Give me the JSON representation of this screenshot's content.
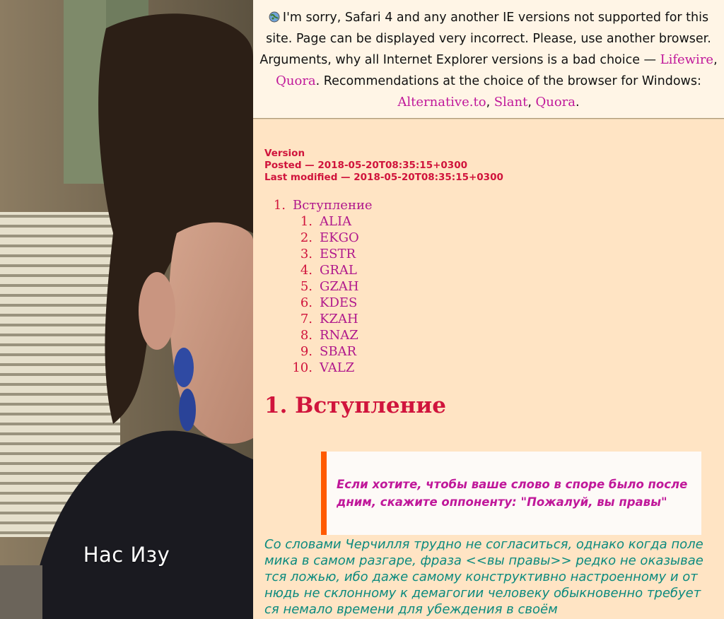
{
  "photo": {
    "caption": "Нас Изу"
  },
  "warning": {
    "icon": "browser-globe-icon",
    "text_1": "I'm sorry, Safari 4 and any another IE versions not supported for this site. Page can be displayed very incorrect. Please, use another browser. Arguments, why all Internet Explorer versions is a bad choice — ",
    "link_lifewire": "Lifewire",
    "sep_1": ", ",
    "link_quora_1": "Quora",
    "text_2": ". Recommendations at the choice of the browser for Windows: ",
    "link_alternative": "Alternative.to",
    "sep_2": ", ",
    "link_slant": "Slant",
    "sep_3": ", ",
    "link_quora_2": "Quora",
    "text_end": "."
  },
  "meta": {
    "version_label": "Version",
    "posted": "Posted — 2018-05-20T08:35:15+0300",
    "modified": "Last modified — 2018-05-20T08:35:15+0300"
  },
  "toc": {
    "main": {
      "num": "1.",
      "label": "Вступление"
    },
    "items": [
      {
        "num": "1.",
        "label": "ALIA"
      },
      {
        "num": "2.",
        "label": "EKGO"
      },
      {
        "num": "3.",
        "label": "ESTR"
      },
      {
        "num": "4.",
        "label": "GRAL"
      },
      {
        "num": "5.",
        "label": "GZAH"
      },
      {
        "num": "6.",
        "label": "KDES"
      },
      {
        "num": "7.",
        "label": "KZAH"
      },
      {
        "num": "8.",
        "label": "RNAZ"
      },
      {
        "num": "9.",
        "label": "SBAR"
      },
      {
        "num": "10.",
        "label": "VALZ"
      }
    ]
  },
  "section": {
    "title": "1. Вступление",
    "quote": "Если хотите, чтобы ваше слово в споре было последним, скажите оппоненту: \"Пожалуй, вы правы\"",
    "paragraph": "Со словами Черчилля трудно не согласиться, однако когда полемика в самом разгаре, фраза <<вы правы>> редко не оказывается ложью, ибо даже самому конструктивно настроенному и отнюдь не склонному к демагогии человеку обыкновенно требуется немало времени для убеждения в своём"
  },
  "colors": {
    "background": "#ffe4c4",
    "warning_bg": "#fff5e6",
    "link": "#c0189a",
    "heading": "#d0143c",
    "quote_border": "#ff5a00",
    "paragraph": "#0b8a7e"
  }
}
